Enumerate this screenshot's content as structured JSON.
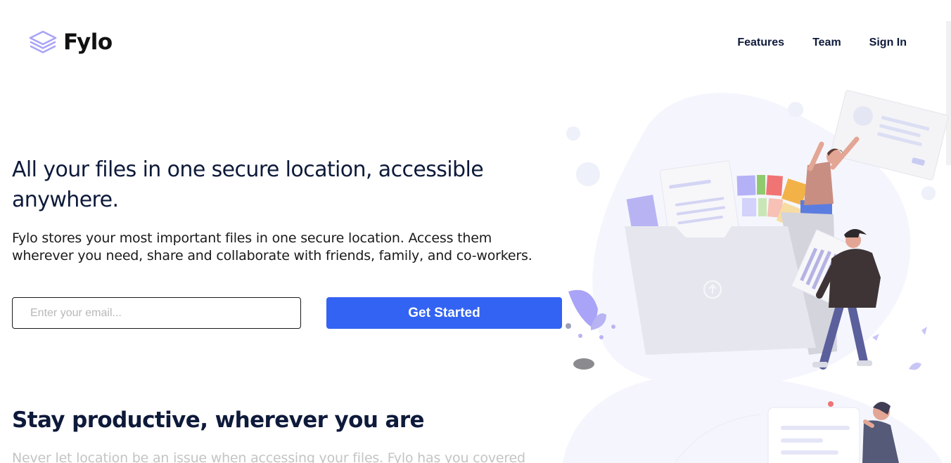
{
  "brand": {
    "name": "Fylo"
  },
  "nav": {
    "items": [
      "Features",
      "Team",
      "Sign In"
    ]
  },
  "hero": {
    "title": "All your files in one secure location, accessible anywhere.",
    "description": "Fylo stores your most important files in one secure location. Access them wherever you need, share and collaborate with friends, family, and co-workers.",
    "email_placeholder": "Enter your email...",
    "cta_label": "Get Started"
  },
  "productive": {
    "title": "Stay productive, wherever you are",
    "description": "Never let location be an issue when accessing your files. Fylo has you covered"
  },
  "colors": {
    "accent": "#3363f2",
    "heading": "#0e1a3a",
    "logo_icon": "#a9a4f7"
  }
}
